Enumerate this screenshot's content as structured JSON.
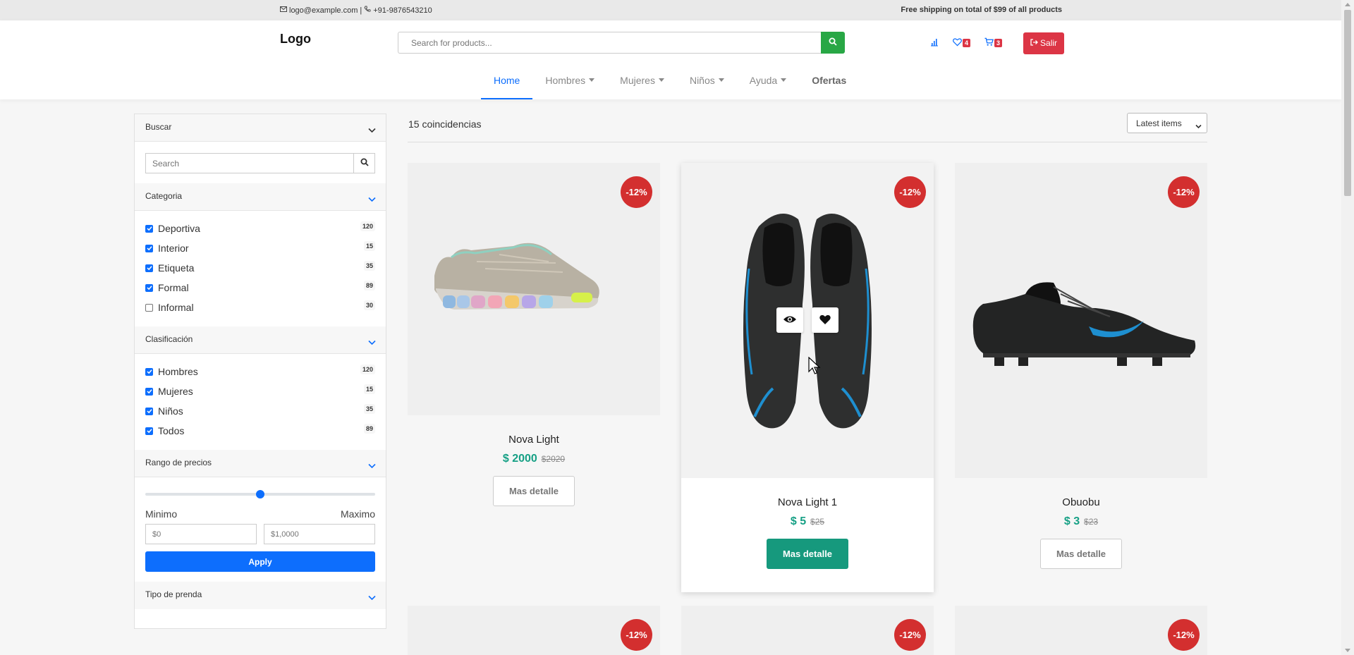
{
  "topbar": {
    "email": "logo@example.com",
    "separator": "|",
    "phone": "+91-9876543210",
    "promo": "Free shipping on total of $99 of all products"
  },
  "header": {
    "logo": "Logo",
    "search_placeholder": "Search for products...",
    "wishlist_count": "4",
    "cart_count": "3",
    "logout_label": "Salir"
  },
  "nav": {
    "items": [
      "Home",
      "Hombres",
      "Mujeres",
      "Niños",
      "Ayuda",
      "Ofertas"
    ]
  },
  "sidebar": {
    "search_title": "Buscar",
    "search_placeholder": "Search",
    "category_title": "Categoria",
    "categories": [
      {
        "label": "Deportiva",
        "count": "120",
        "checked": true
      },
      {
        "label": "Interior",
        "count": "15",
        "checked": true
      },
      {
        "label": "Etiqueta",
        "count": "35",
        "checked": true
      },
      {
        "label": "Formal",
        "count": "89",
        "checked": true
      },
      {
        "label": "Informal",
        "count": "30",
        "checked": false
      }
    ],
    "classification_title": "Clasificación",
    "classifications": [
      {
        "label": "Hombres",
        "count": "120",
        "checked": true
      },
      {
        "label": "Mujeres",
        "count": "15",
        "checked": true
      },
      {
        "label": "Niños",
        "count": "35",
        "checked": true
      },
      {
        "label": "Todos",
        "count": "89",
        "checked": true
      }
    ],
    "price_title": "Rango de precios",
    "price_slider_value": 0.5,
    "min_label": "Minimo",
    "max_label": "Maximo",
    "min_placeholder": "$0",
    "max_placeholder": "$1,0000",
    "apply_label": "Apply",
    "garment_title": "Tipo de prenda"
  },
  "results": {
    "count_text": "15 coincidencias",
    "sort_value": "Latest items"
  },
  "products": [
    {
      "name": "Nova Light",
      "price": "$ 2000",
      "old_price": "$2020",
      "discount": "-12%",
      "button": "Mas detalle"
    },
    {
      "name": "Nova Light 1",
      "price": "$ 5",
      "old_price": "$25",
      "discount": "-12%",
      "button": "Mas detalle"
    },
    {
      "name": "Obuobu",
      "price": "$ 3",
      "old_price": "$23",
      "discount": "-12%",
      "button": "Mas detalle"
    },
    {
      "discount": "-12%"
    },
    {
      "discount": "-12%"
    },
    {
      "discount": "-12%"
    }
  ],
  "colors": {
    "primary": "#0d6efd",
    "danger": "#dc3545",
    "success": "#28a745",
    "teal": "#16997d",
    "price_green": "#16a085"
  }
}
